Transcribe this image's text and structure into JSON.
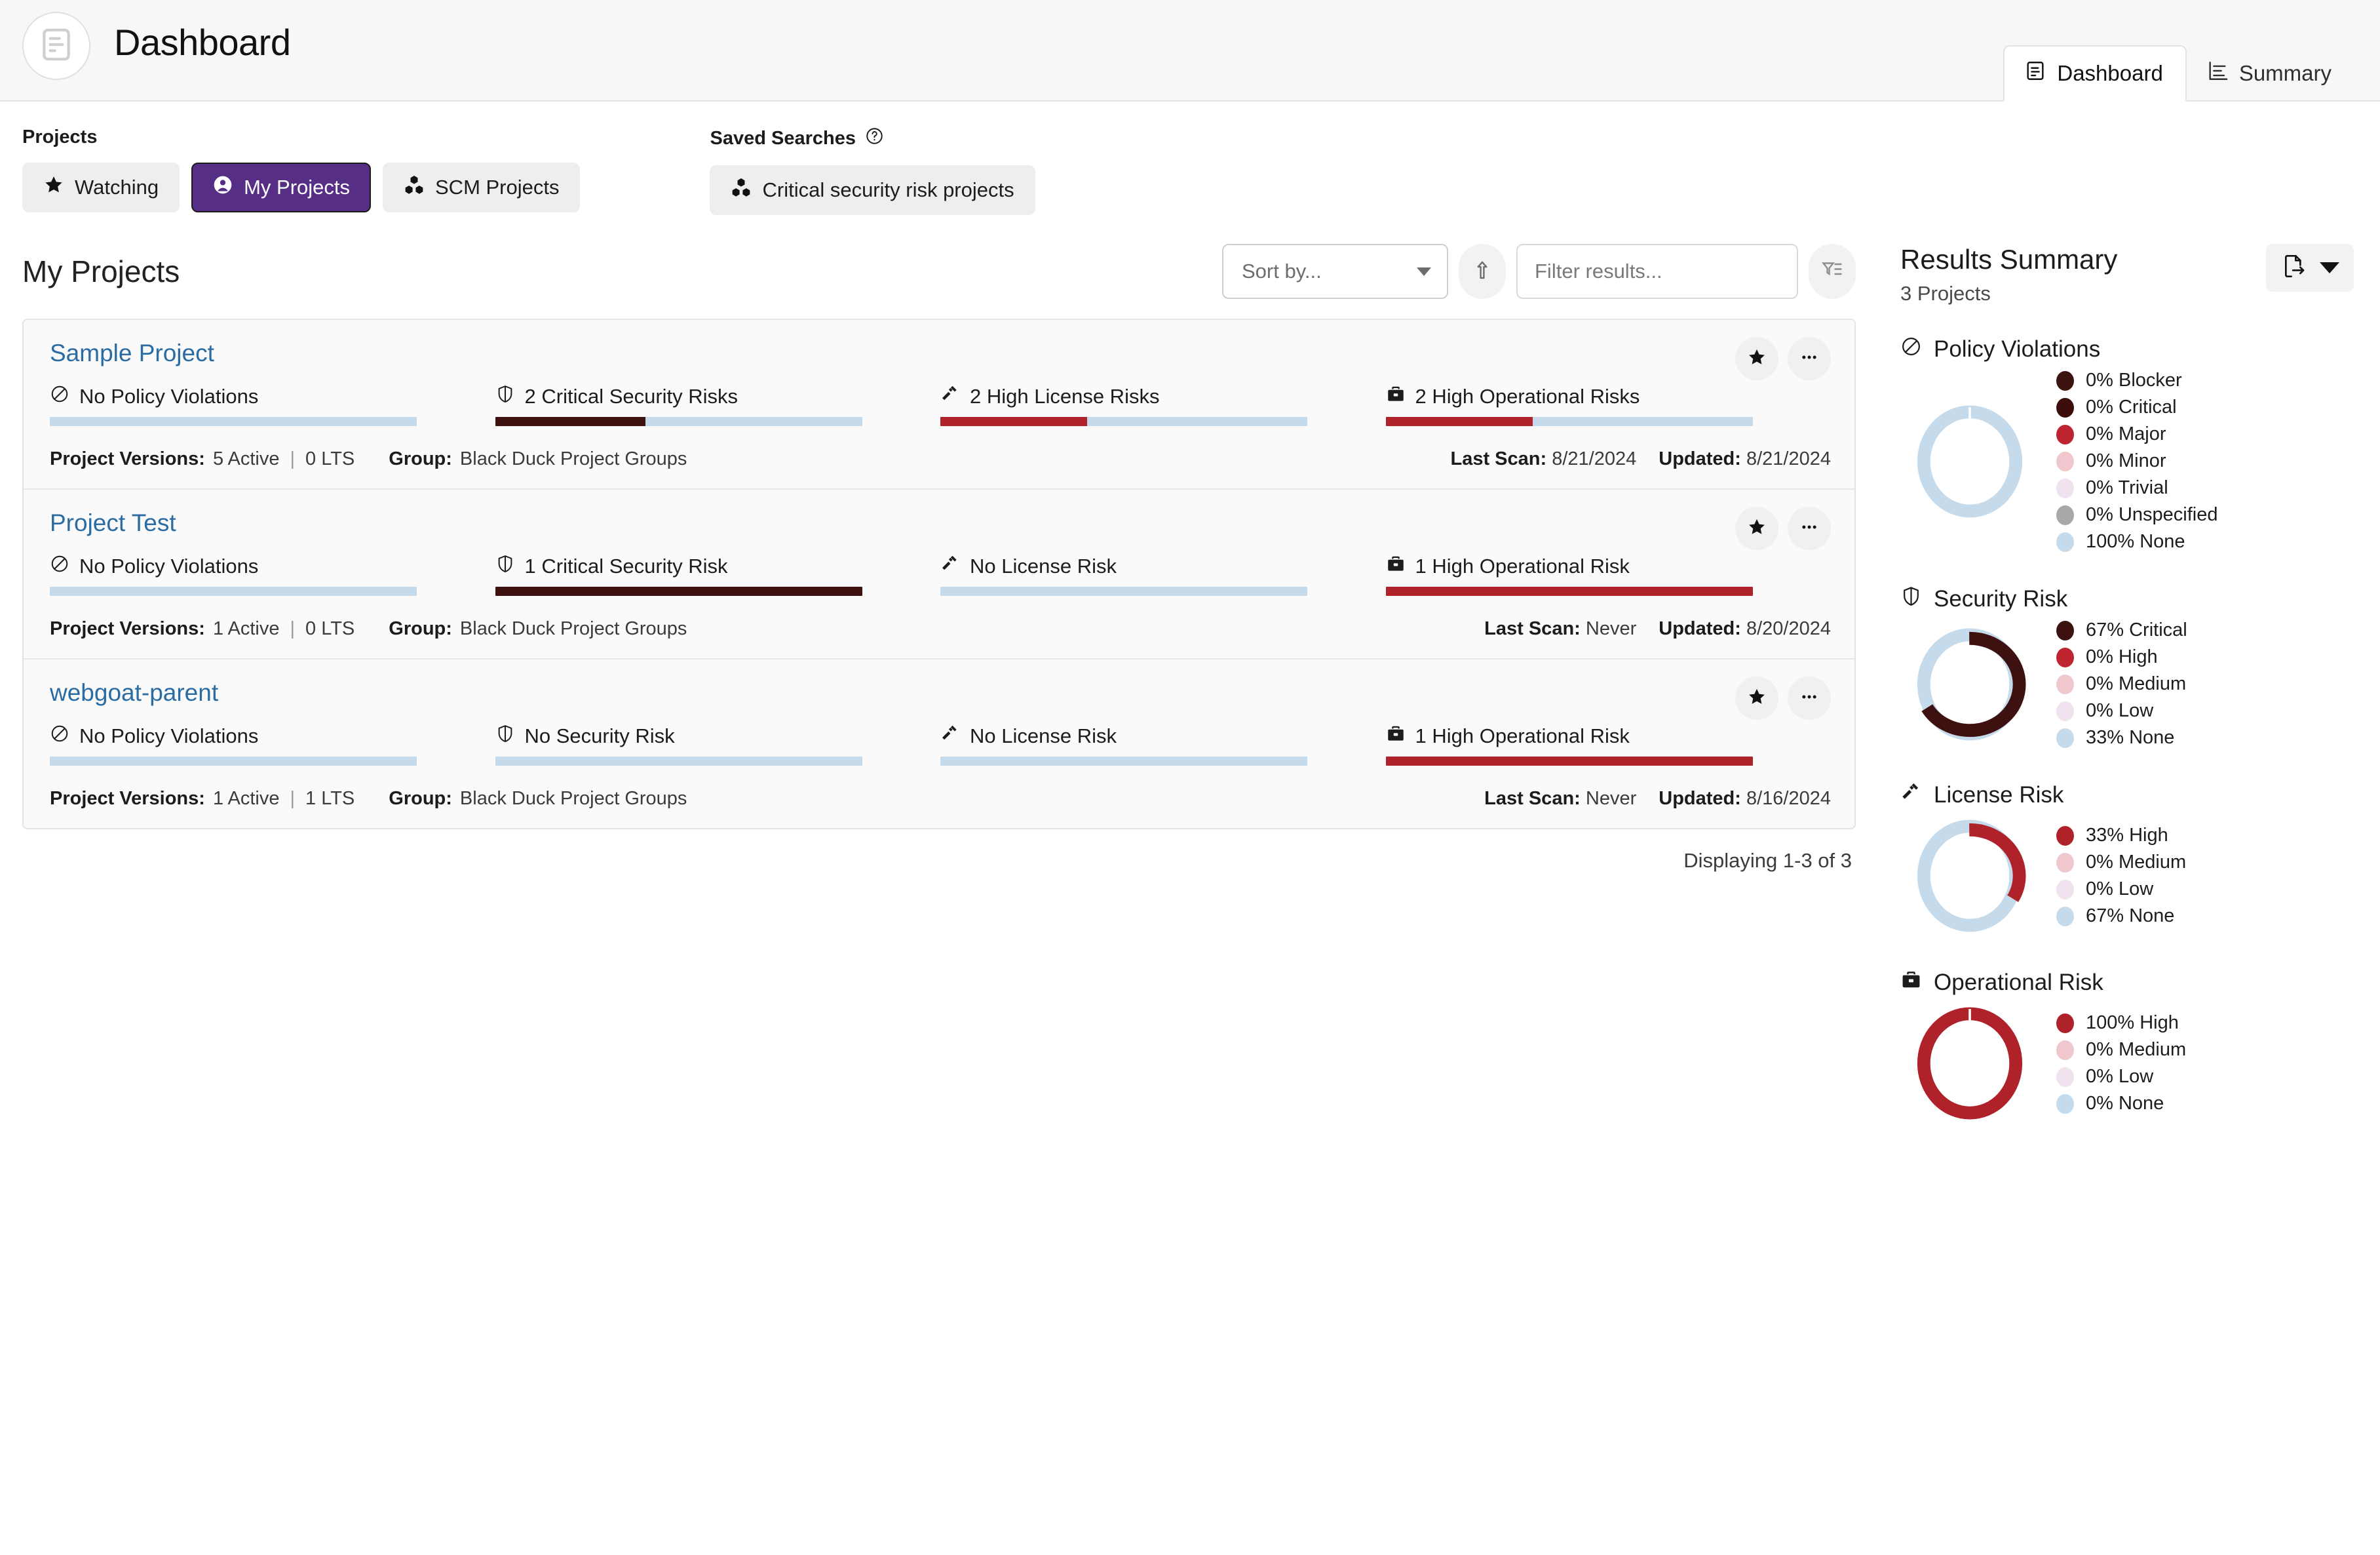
{
  "header": {
    "title": "Dashboard",
    "logo_icon": "document-list-icon",
    "tabs": [
      {
        "label": "Dashboard",
        "icon": "document-list-icon",
        "active": true
      },
      {
        "label": "Summary",
        "icon": "bar-chart-icon",
        "active": false
      }
    ]
  },
  "filters": {
    "projects_label": "Projects",
    "saved_searches_label": "Saved Searches",
    "help_icon": "question-circle-icon",
    "project_chips": [
      {
        "label": "Watching",
        "icon": "star-icon",
        "selected": false
      },
      {
        "label": "My Projects",
        "icon": "user-circle-icon",
        "selected": true
      },
      {
        "label": "SCM Projects",
        "icon": "cubes-icon",
        "selected": false
      }
    ],
    "saved_searches": [
      {
        "label": "Critical security risk projects",
        "icon": "cubes-icon",
        "selected": false
      }
    ]
  },
  "toolbar": {
    "heading": "My Projects",
    "sort_value": "Sort by...",
    "sort_caret_icon": "chevron-down-icon",
    "sort_direction_icon": "arrow-up-icon",
    "filter_placeholder": "Filter results...",
    "filter_value": "",
    "advanced_filter_icon": "filter-list-icon"
  },
  "projects": [
    {
      "name": "Sample Project",
      "star_icon": "star-icon",
      "more_icon": "ellipsis-icon",
      "metrics": [
        {
          "icon": "no-policy-icon",
          "label": "No Policy Violations",
          "fill_pct": 0,
          "fill_color": "#c5dbeb",
          "track_color": "#c5dbeb"
        },
        {
          "icon": "shield-icon",
          "label": "2 Critical Security Risks",
          "fill_pct": 41,
          "fill_color": "#3d110f",
          "track_color": "#c5dbeb"
        },
        {
          "icon": "gavel-icon",
          "label": "2 High License Risks",
          "fill_pct": 40,
          "fill_color": "#b0222a",
          "track_color": "#c5dbeb"
        },
        {
          "icon": "briefcase-icon",
          "label": "2 High Operational Risks",
          "fill_pct": 40,
          "fill_color": "#b0222a",
          "track_color": "#c5dbeb"
        }
      ],
      "versions_label": "Project Versions:",
      "versions_active": "5 Active",
      "versions_lts": "0 LTS",
      "group_label": "Group:",
      "group_value": "Black Duck Project Groups",
      "last_scan_label": "Last Scan:",
      "last_scan_value": "8/21/2024",
      "updated_label": "Updated:",
      "updated_value": "8/21/2024"
    },
    {
      "name": "Project Test",
      "star_icon": "star-icon",
      "more_icon": "ellipsis-icon",
      "metrics": [
        {
          "icon": "no-policy-icon",
          "label": "No Policy Violations",
          "fill_pct": 0,
          "fill_color": "#c5dbeb",
          "track_color": "#c5dbeb"
        },
        {
          "icon": "shield-icon",
          "label": "1 Critical Security Risk",
          "fill_pct": 100,
          "fill_color": "#3d110f",
          "track_color": "#c5dbeb"
        },
        {
          "icon": "gavel-icon",
          "label": "No License Risk",
          "fill_pct": 0,
          "fill_color": "#c5dbeb",
          "track_color": "#c5dbeb"
        },
        {
          "icon": "briefcase-icon",
          "label": "1 High Operational Risk",
          "fill_pct": 100,
          "fill_color": "#b0222a",
          "track_color": "#c5dbeb"
        }
      ],
      "versions_label": "Project Versions:",
      "versions_active": "1 Active",
      "versions_lts": "0 LTS",
      "group_label": "Group:",
      "group_value": "Black Duck Project Groups",
      "last_scan_label": "Last Scan:",
      "last_scan_value": "Never",
      "updated_label": "Updated:",
      "updated_value": "8/20/2024"
    },
    {
      "name": "webgoat-parent",
      "star_icon": "star-icon",
      "more_icon": "ellipsis-icon",
      "metrics": [
        {
          "icon": "no-policy-icon",
          "label": "No Policy Violations",
          "fill_pct": 0,
          "fill_color": "#c5dbeb",
          "track_color": "#c5dbeb"
        },
        {
          "icon": "shield-icon",
          "label": "No Security Risk",
          "fill_pct": 0,
          "fill_color": "#c5dbeb",
          "track_color": "#c5dbeb"
        },
        {
          "icon": "gavel-icon",
          "label": "No License Risk",
          "fill_pct": 0,
          "fill_color": "#c5dbeb",
          "track_color": "#c5dbeb"
        },
        {
          "icon": "briefcase-icon",
          "label": "1 High Operational Risk",
          "fill_pct": 100,
          "fill_color": "#b0222a",
          "track_color": "#c5dbeb"
        }
      ],
      "versions_label": "Project Versions:",
      "versions_active": "1 Active",
      "versions_lts": "1 LTS",
      "group_label": "Group:",
      "group_value": "Black Duck Project Groups",
      "last_scan_label": "Last Scan:",
      "last_scan_value": "Never",
      "updated_label": "Updated:",
      "updated_value": "8/16/2024"
    }
  ],
  "pagination": {
    "displaying": "Displaying 1-3 of 3"
  },
  "summary": {
    "title": "Results Summary",
    "subtitle": "3 Projects",
    "export_icon": "file-export-icon",
    "export_caret_icon": "caret-down-icon"
  },
  "chart_data": [
    {
      "type": "pie",
      "title": "Policy Violations",
      "icon": "no-policy-icon",
      "legend_position": "right",
      "categories": [
        "Blocker",
        "Critical",
        "Major",
        "Minor",
        "Trivial",
        "Unspecified",
        "None"
      ],
      "values": [
        0,
        0,
        0,
        0,
        0,
        0,
        100
      ],
      "labels": [
        "0% Blocker",
        "0% Critical",
        "0% Major",
        "0% Minor",
        "0% Trivial",
        "0% Unspecified",
        "100% None"
      ],
      "colors": [
        "#3d1310",
        "#3d0d0c",
        "#be2531",
        "#f0c7cd",
        "#f0e2ef",
        "#a8a8a8",
        "#c5dbeb"
      ]
    },
    {
      "type": "pie",
      "title": "Security Risk",
      "icon": "shield-icon",
      "legend_position": "right",
      "categories": [
        "Critical",
        "High",
        "Medium",
        "Low",
        "None"
      ],
      "values": [
        67,
        0,
        0,
        0,
        33
      ],
      "labels": [
        "67% Critical",
        "0% High",
        "0% Medium",
        "0% Low",
        "33% None"
      ],
      "colors": [
        "#3d110f",
        "#be2531",
        "#f0c7cd",
        "#f0e2ef",
        "#c5dbeb"
      ]
    },
    {
      "type": "pie",
      "title": "License Risk",
      "icon": "gavel-icon",
      "legend_position": "right",
      "categories": [
        "High",
        "Medium",
        "Low",
        "None"
      ],
      "values": [
        33,
        0,
        0,
        67
      ],
      "labels": [
        "33% High",
        "0% Medium",
        "0% Low",
        "67% None"
      ],
      "colors": [
        "#b0222a",
        "#f0c7cd",
        "#f0e2ef",
        "#c5dbeb"
      ]
    },
    {
      "type": "pie",
      "title": "Operational Risk",
      "icon": "briefcase-icon",
      "legend_position": "right",
      "categories": [
        "High",
        "Medium",
        "Low",
        "None"
      ],
      "values": [
        100,
        0,
        0,
        0
      ],
      "labels": [
        "100% High",
        "0% Medium",
        "0% Low",
        "0% None"
      ],
      "colors": [
        "#b0222a",
        "#f0c7cd",
        "#f0e2ef",
        "#c5dbeb"
      ]
    }
  ]
}
